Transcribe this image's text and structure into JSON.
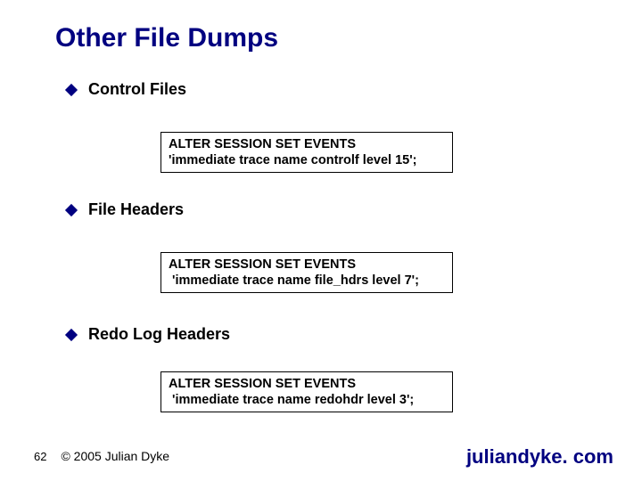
{
  "title": "Other File Dumps",
  "sections": [
    {
      "label": "Control Files",
      "code": "ALTER SESSION SET EVENTS\n'immediate trace name controlf level 15';"
    },
    {
      "label": "File Headers",
      "code": "ALTER SESSION SET EVENTS\n 'immediate trace name file_hdrs level 7';"
    },
    {
      "label": "Redo Log Headers",
      "code": "ALTER SESSION SET EVENTS\n 'immediate trace name redohdr level 3';"
    }
  ],
  "footer": {
    "page_number": "62",
    "copyright": "© 2005 Julian Dyke",
    "site": "juliandyke. com"
  }
}
